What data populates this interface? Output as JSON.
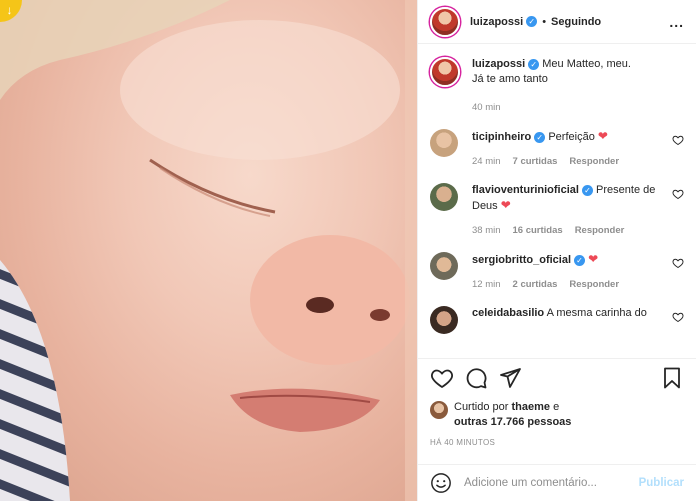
{
  "header": {
    "username": "luizapossi",
    "separator": "•",
    "follow_state": "Seguindo",
    "more": "..."
  },
  "caption": {
    "username": "luizapossi",
    "text_line1": "Meu Matteo, meu.",
    "text_line2": "Já te amo tanto",
    "time": "40 min"
  },
  "comments": [
    {
      "username": "ticipinheiro",
      "text": "Perfeição",
      "heart": "❤",
      "time": "24 min",
      "likes": "7 curtidas",
      "reply": "Responder"
    },
    {
      "username": "flavioventurinioficial",
      "text": "Presente de",
      "text2": "Deus",
      "heart": "❤",
      "time": "38 min",
      "likes": "16 curtidas",
      "reply": "Responder"
    },
    {
      "username": "sergiobritto_oficial",
      "text": "",
      "heart": "❤",
      "time": "12 min",
      "likes": "2 curtidas",
      "reply": "Responder"
    },
    {
      "username": "celeidabasilio",
      "text": "A mesma carinha do"
    }
  ],
  "likes": {
    "prefix": "Curtido por",
    "user": "thaeme",
    "mid": "e",
    "others": "outras 17.766 pessoas"
  },
  "timestamp": "Há 40 minutos",
  "add_comment": {
    "placeholder": "Adicione um comentário...",
    "publish": "Publicar"
  },
  "colors": {
    "accent_blue": "#3897f0",
    "heart_red": "#ed4956",
    "muted": "#8e8e8e"
  }
}
